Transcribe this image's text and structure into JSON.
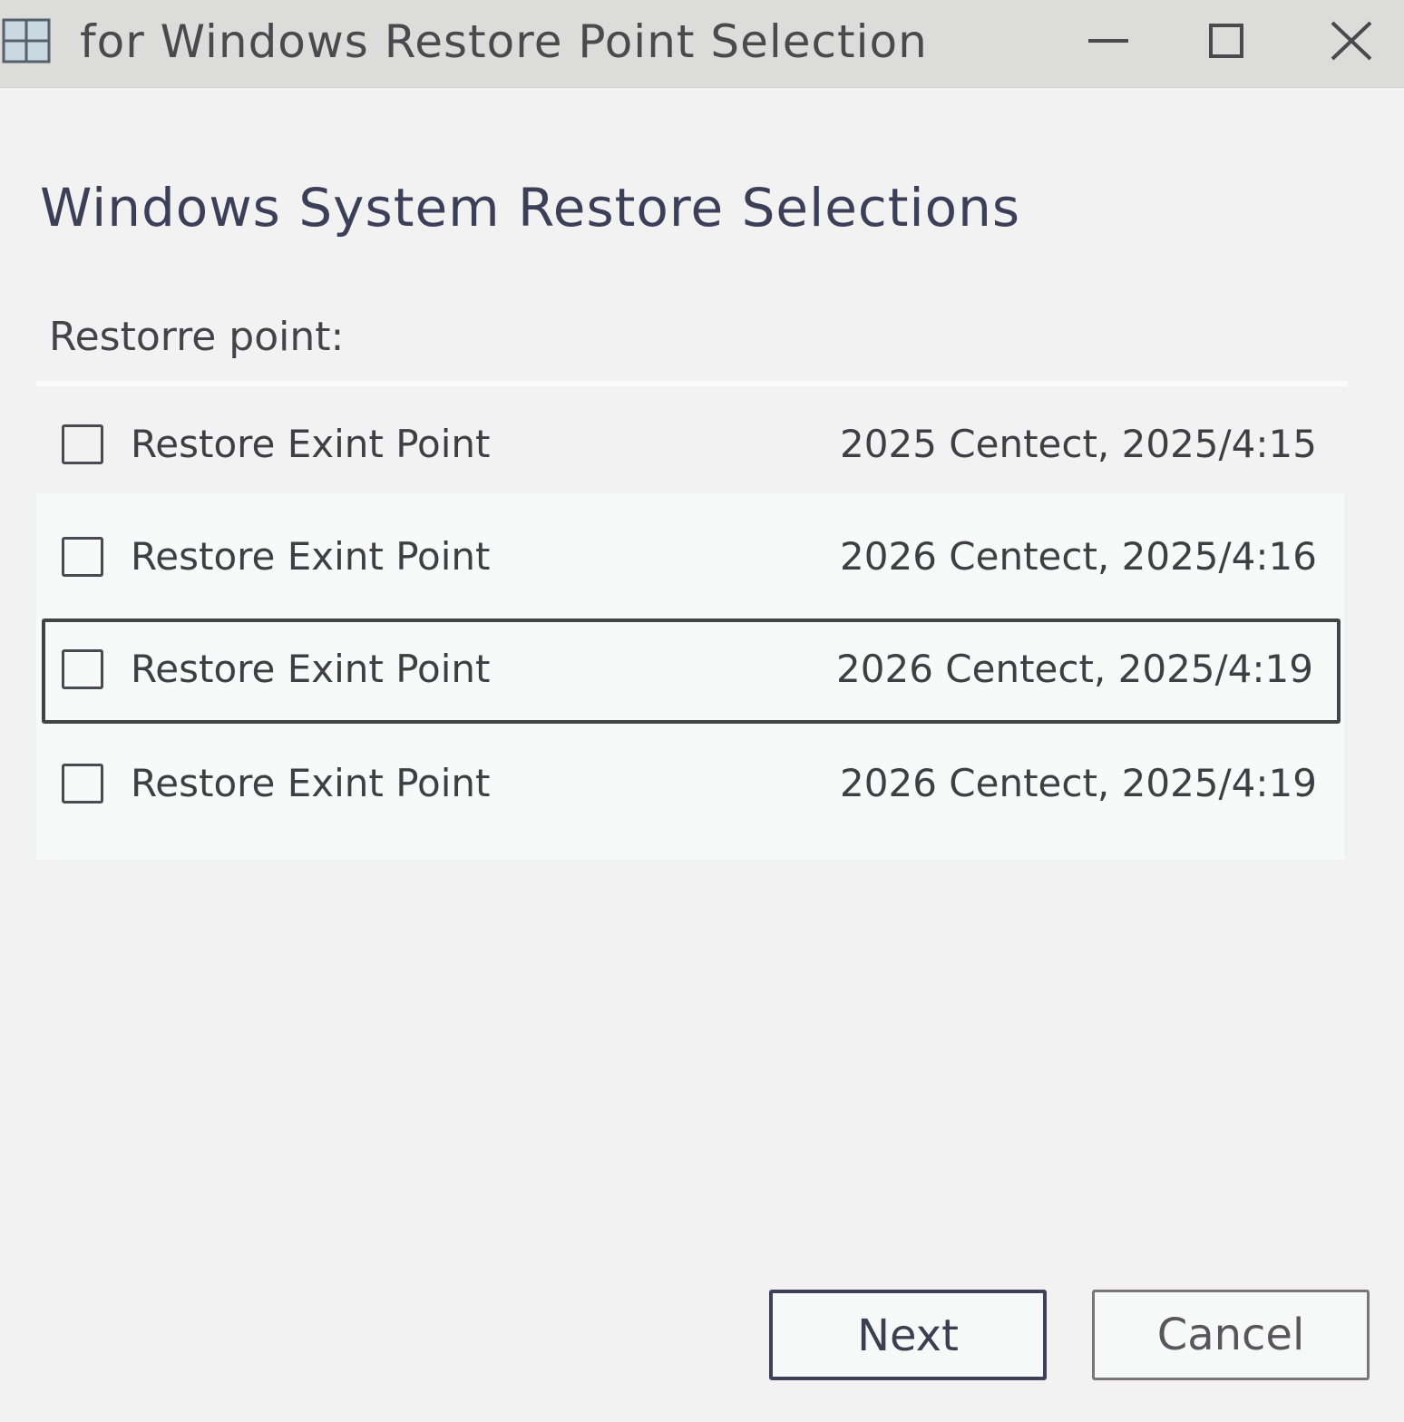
{
  "window": {
    "title": "for Windows Restore Point Selection",
    "icons": {
      "app": "windows-grid-icon",
      "minimize": "minimize-icon",
      "maximize": "maximize-icon",
      "close": "close-icon"
    }
  },
  "main": {
    "heading": "Windows System Restore Selections",
    "field_label": "Restorre point:",
    "restore_points": [
      {
        "name": "Restore Exint Point",
        "date": "2025 Centect, 2025/4:15",
        "checked": false,
        "selected": false
      },
      {
        "name": "Restore Exint Point",
        "date": "2026 Centect, 2025/4:16",
        "checked": false,
        "selected": false
      },
      {
        "name": "Restore Exint Point",
        "date": "2026 Centect, 2025/4:19",
        "checked": false,
        "selected": true
      },
      {
        "name": "Restore Exint Point",
        "date": "2026 Centect, 2025/4:19",
        "checked": false,
        "selected": false
      }
    ]
  },
  "footer": {
    "next_label": "Next",
    "cancel_label": "Cancel"
  },
  "colors": {
    "titlebar": "#dcdcda",
    "heading": "#3c3f58",
    "next_border": "#3e4258",
    "cancel_border": "#7a7676"
  }
}
